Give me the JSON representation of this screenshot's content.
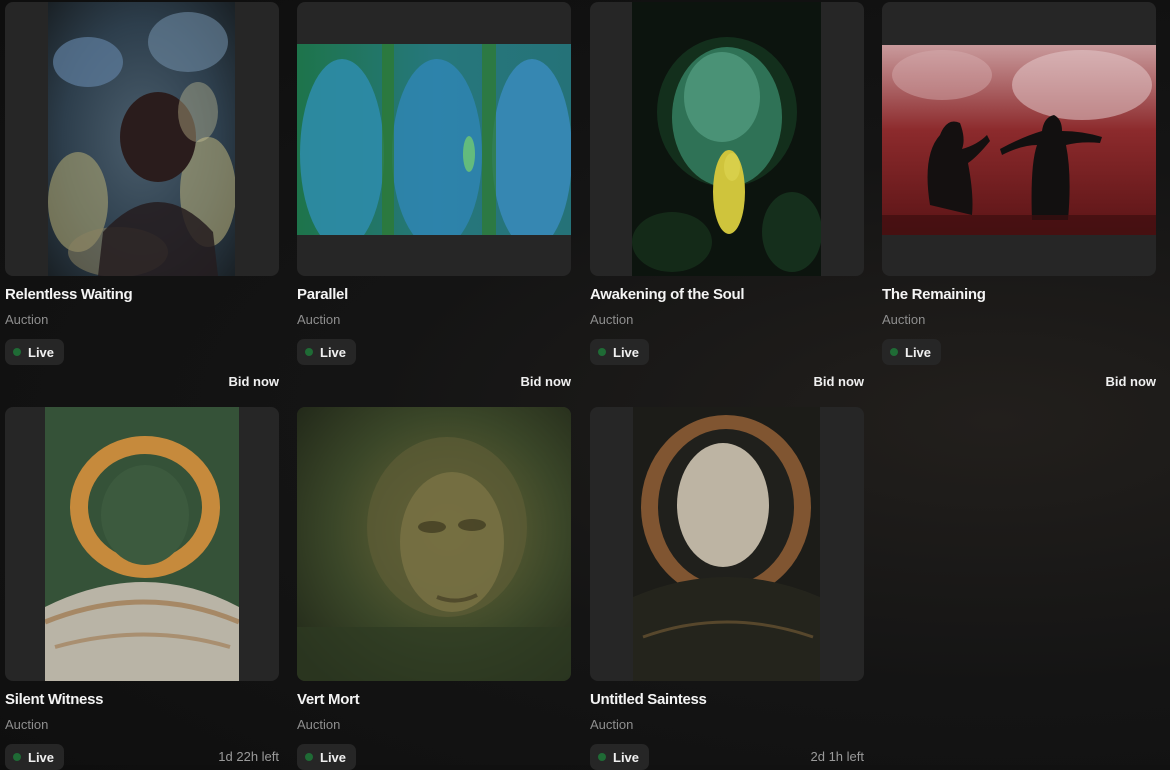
{
  "cards": [
    {
      "title": "Relentless Waiting",
      "subtitle": "Auction",
      "status": "Live",
      "action": "Bid now"
    },
    {
      "title": "Parallel",
      "subtitle": "Auction",
      "status": "Live",
      "action": "Bid now"
    },
    {
      "title": "Awakening of the Soul",
      "subtitle": "Auction",
      "status": "Live",
      "action": "Bid now"
    },
    {
      "title": "The Remaining",
      "subtitle": "Auction",
      "status": "Live",
      "action": "Bid now"
    },
    {
      "title": "Silent Witness",
      "subtitle": "Auction",
      "status": "Live",
      "time_left": "1d 22h left"
    },
    {
      "title": "Vert Mort",
      "subtitle": "Auction",
      "status": "Live"
    },
    {
      "title": "Untitled Saintess",
      "subtitle": "Auction",
      "status": "Live",
      "time_left": "2d 1h left"
    }
  ],
  "colors": {
    "live_dot": "#1f6b35",
    "card_bg": "#262626",
    "subtitle": "#8e8e8e"
  }
}
